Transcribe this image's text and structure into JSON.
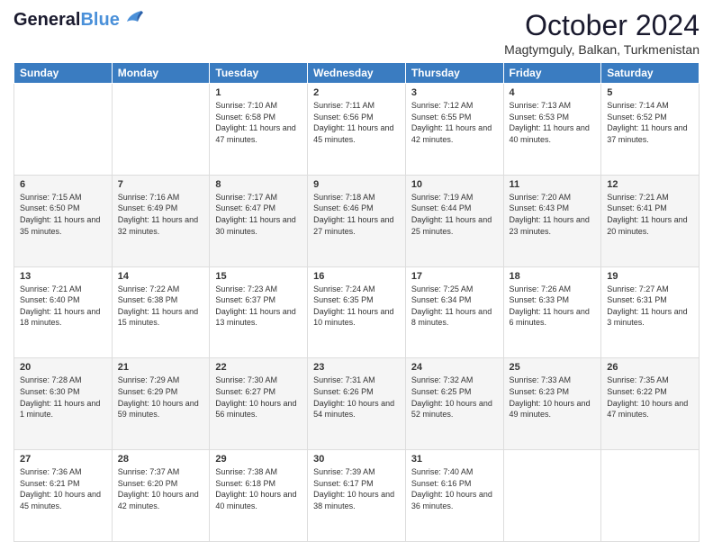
{
  "header": {
    "logo_general": "General",
    "logo_blue": "Blue",
    "month_year": "October 2024",
    "location": "Magtymguly, Balkan, Turkmenistan"
  },
  "weekdays": [
    "Sunday",
    "Monday",
    "Tuesday",
    "Wednesday",
    "Thursday",
    "Friday",
    "Saturday"
  ],
  "weeks": [
    [
      {
        "day": "",
        "content": ""
      },
      {
        "day": "",
        "content": ""
      },
      {
        "day": "1",
        "content": "Sunrise: 7:10 AM\nSunset: 6:58 PM\nDaylight: 11 hours and 47 minutes."
      },
      {
        "day": "2",
        "content": "Sunrise: 7:11 AM\nSunset: 6:56 PM\nDaylight: 11 hours and 45 minutes."
      },
      {
        "day": "3",
        "content": "Sunrise: 7:12 AM\nSunset: 6:55 PM\nDaylight: 11 hours and 42 minutes."
      },
      {
        "day": "4",
        "content": "Sunrise: 7:13 AM\nSunset: 6:53 PM\nDaylight: 11 hours and 40 minutes."
      },
      {
        "day": "5",
        "content": "Sunrise: 7:14 AM\nSunset: 6:52 PM\nDaylight: 11 hours and 37 minutes."
      }
    ],
    [
      {
        "day": "6",
        "content": "Sunrise: 7:15 AM\nSunset: 6:50 PM\nDaylight: 11 hours and 35 minutes."
      },
      {
        "day": "7",
        "content": "Sunrise: 7:16 AM\nSunset: 6:49 PM\nDaylight: 11 hours and 32 minutes."
      },
      {
        "day": "8",
        "content": "Sunrise: 7:17 AM\nSunset: 6:47 PM\nDaylight: 11 hours and 30 minutes."
      },
      {
        "day": "9",
        "content": "Sunrise: 7:18 AM\nSunset: 6:46 PM\nDaylight: 11 hours and 27 minutes."
      },
      {
        "day": "10",
        "content": "Sunrise: 7:19 AM\nSunset: 6:44 PM\nDaylight: 11 hours and 25 minutes."
      },
      {
        "day": "11",
        "content": "Sunrise: 7:20 AM\nSunset: 6:43 PM\nDaylight: 11 hours and 23 minutes."
      },
      {
        "day": "12",
        "content": "Sunrise: 7:21 AM\nSunset: 6:41 PM\nDaylight: 11 hours and 20 minutes."
      }
    ],
    [
      {
        "day": "13",
        "content": "Sunrise: 7:21 AM\nSunset: 6:40 PM\nDaylight: 11 hours and 18 minutes."
      },
      {
        "day": "14",
        "content": "Sunrise: 7:22 AM\nSunset: 6:38 PM\nDaylight: 11 hours and 15 minutes."
      },
      {
        "day": "15",
        "content": "Sunrise: 7:23 AM\nSunset: 6:37 PM\nDaylight: 11 hours and 13 minutes."
      },
      {
        "day": "16",
        "content": "Sunrise: 7:24 AM\nSunset: 6:35 PM\nDaylight: 11 hours and 10 minutes."
      },
      {
        "day": "17",
        "content": "Sunrise: 7:25 AM\nSunset: 6:34 PM\nDaylight: 11 hours and 8 minutes."
      },
      {
        "day": "18",
        "content": "Sunrise: 7:26 AM\nSunset: 6:33 PM\nDaylight: 11 hours and 6 minutes."
      },
      {
        "day": "19",
        "content": "Sunrise: 7:27 AM\nSunset: 6:31 PM\nDaylight: 11 hours and 3 minutes."
      }
    ],
    [
      {
        "day": "20",
        "content": "Sunrise: 7:28 AM\nSunset: 6:30 PM\nDaylight: 11 hours and 1 minute."
      },
      {
        "day": "21",
        "content": "Sunrise: 7:29 AM\nSunset: 6:29 PM\nDaylight: 10 hours and 59 minutes."
      },
      {
        "day": "22",
        "content": "Sunrise: 7:30 AM\nSunset: 6:27 PM\nDaylight: 10 hours and 56 minutes."
      },
      {
        "day": "23",
        "content": "Sunrise: 7:31 AM\nSunset: 6:26 PM\nDaylight: 10 hours and 54 minutes."
      },
      {
        "day": "24",
        "content": "Sunrise: 7:32 AM\nSunset: 6:25 PM\nDaylight: 10 hours and 52 minutes."
      },
      {
        "day": "25",
        "content": "Sunrise: 7:33 AM\nSunset: 6:23 PM\nDaylight: 10 hours and 49 minutes."
      },
      {
        "day": "26",
        "content": "Sunrise: 7:35 AM\nSunset: 6:22 PM\nDaylight: 10 hours and 47 minutes."
      }
    ],
    [
      {
        "day": "27",
        "content": "Sunrise: 7:36 AM\nSunset: 6:21 PM\nDaylight: 10 hours and 45 minutes."
      },
      {
        "day": "28",
        "content": "Sunrise: 7:37 AM\nSunset: 6:20 PM\nDaylight: 10 hours and 42 minutes."
      },
      {
        "day": "29",
        "content": "Sunrise: 7:38 AM\nSunset: 6:18 PM\nDaylight: 10 hours and 40 minutes."
      },
      {
        "day": "30",
        "content": "Sunrise: 7:39 AM\nSunset: 6:17 PM\nDaylight: 10 hours and 38 minutes."
      },
      {
        "day": "31",
        "content": "Sunrise: 7:40 AM\nSunset: 6:16 PM\nDaylight: 10 hours and 36 minutes."
      },
      {
        "day": "",
        "content": ""
      },
      {
        "day": "",
        "content": ""
      }
    ]
  ]
}
